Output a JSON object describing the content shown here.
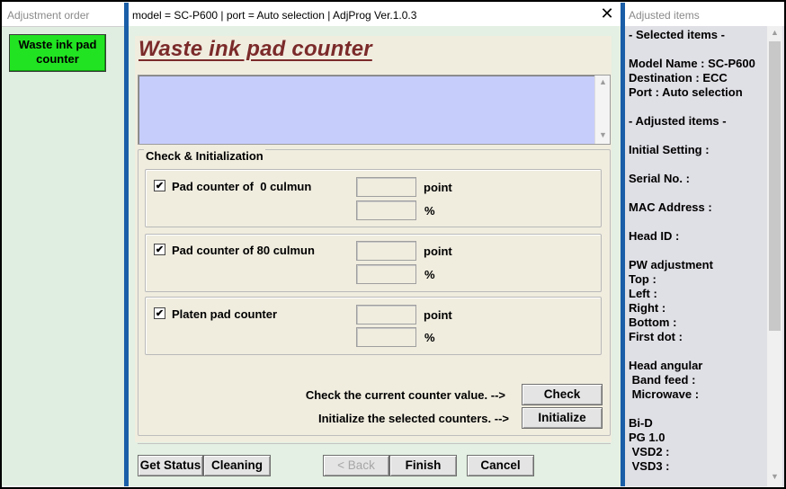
{
  "left": {
    "title": "Adjustment order",
    "active_item": "Waste ink pad counter"
  },
  "window": {
    "title": "model = SC-P600 | port = Auto selection | AdjProg Ver.1.0.3",
    "close_glyph": "✕"
  },
  "main": {
    "heading": "Waste ink pad counter",
    "info_text": "",
    "group_label": "Check & Initialization",
    "pads": [
      {
        "label": "Pad counter of  0 culmun",
        "checked": true,
        "point": "",
        "percent": ""
      },
      {
        "label": "Pad counter of 80 culmun",
        "checked": true,
        "point": "",
        "percent": ""
      },
      {
        "label": "Platen pad counter",
        "checked": true,
        "point": "",
        "percent": ""
      }
    ],
    "unit_point": "point",
    "unit_percent": "%",
    "check_hint": "Check the current counter value. -->",
    "check_button": "Check",
    "init_hint": "Initialize the selected counters. -->",
    "init_button": "Initialize",
    "checkmark": "✔"
  },
  "footer": {
    "get_status": "Get Status",
    "cleaning": "Cleaning",
    "back": "< Back",
    "finish": "Finish",
    "cancel": "Cancel"
  },
  "right": {
    "title": "Adjusted items",
    "lines": [
      "- Selected items -",
      "",
      "Model Name : SC-P600",
      "Destination : ECC",
      "Port : Auto selection",
      "",
      "- Adjusted items -",
      "",
      "Initial Setting :",
      "",
      "Serial No. :",
      "",
      "MAC Address :",
      "",
      "Head ID :",
      "",
      "PW adjustment",
      "Top :",
      "Left :",
      "Right :",
      "Bottom :",
      "First dot :",
      "",
      "Head angular",
      " Band feed :",
      " Microwave :",
      "",
      "Bi-D",
      "PG 1.0",
      " VSD2 :",
      " VSD3 :"
    ]
  },
  "colors": {
    "accent_blue": "#1a5ea8",
    "active_green": "#22e322",
    "heading_maroon": "#7b2a2a",
    "info_lavender": "#c7cdfb"
  }
}
